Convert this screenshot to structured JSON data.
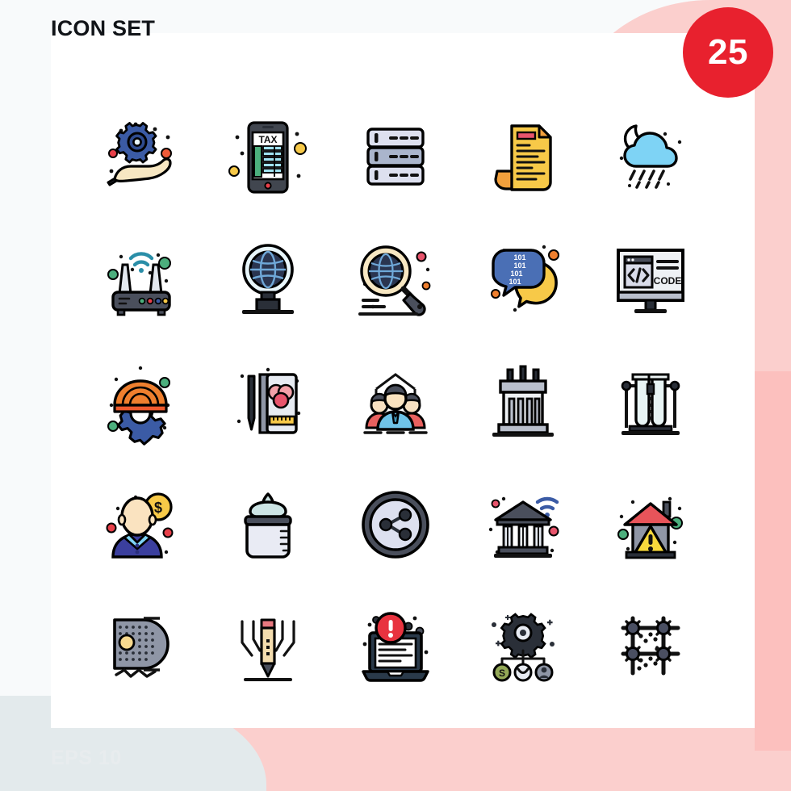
{
  "header": {
    "title": "ICON SET",
    "badge_count": "25",
    "footer_note": "EPS 10"
  },
  "colors": {
    "badge_bg": "#e8212e",
    "badge_text": "#ffffff",
    "title_text": "#111418",
    "footer_text": "#e8ecee",
    "deco_pink": "#fbcfcd",
    "deco_pink_dark": "#fbbdbb",
    "deco_grey": "#e3eaec",
    "card_bg": "#ffffff",
    "page_bg": "#f8fafb",
    "stroke": "#000000",
    "blue": "#3b5ba5",
    "light_blue": "#7ed3f5",
    "yellow": "#f7c948",
    "orange": "#ef7f2e",
    "red": "#e8404a",
    "green": "#4caf7d",
    "cream": "#f7e7c2",
    "lavender": "#d9dcea",
    "slate": "#4a4f5c",
    "teal": "#54c3d8"
  },
  "grid": {
    "rows": 5,
    "columns": 5,
    "total": 25
  },
  "icons": [
    {
      "index": 1,
      "name": "hand-gear-support-icon",
      "label": "Hand with Gear"
    },
    {
      "index": 2,
      "name": "mobile-tax-icon",
      "label": "Mobile Tax",
      "text": "TAX"
    },
    {
      "index": 3,
      "name": "server-rack-icon",
      "label": "Server Rack"
    },
    {
      "index": 4,
      "name": "invoice-document-icon",
      "label": "Invoice Document"
    },
    {
      "index": 5,
      "name": "night-rain-cloud-icon",
      "label": "Night Rain Cloud"
    },
    {
      "index": 6,
      "name": "wifi-router-icon",
      "label": "Wifi Router"
    },
    {
      "index": 7,
      "name": "globe-stand-icon",
      "label": "Globe on Stand"
    },
    {
      "index": 8,
      "name": "global-search-icon",
      "label": "Global Search"
    },
    {
      "index": 9,
      "name": "binary-chat-icon",
      "label": "Binary Chat",
      "text": "101"
    },
    {
      "index": 10,
      "name": "monitor-code-icon",
      "label": "Monitor Code",
      "text": "CODE"
    },
    {
      "index": 11,
      "name": "helmet-gear-engineering-icon",
      "label": "Helmet with Gear"
    },
    {
      "index": 12,
      "name": "design-book-icon",
      "label": "Design Book"
    },
    {
      "index": 13,
      "name": "team-group-icon",
      "label": "Team Group"
    },
    {
      "index": 14,
      "name": "factory-building-icon",
      "label": "Factory Building"
    },
    {
      "index": 15,
      "name": "test-tubes-icon",
      "label": "Test Tubes"
    },
    {
      "index": 16,
      "name": "businessman-money-icon",
      "label": "Businessman with Money",
      "text": "$"
    },
    {
      "index": 17,
      "name": "baby-bottle-icon",
      "label": "Baby Bottle"
    },
    {
      "index": 18,
      "name": "share-button-icon",
      "label": "Share Button"
    },
    {
      "index": 19,
      "name": "online-banking-icon",
      "label": "Online Banking"
    },
    {
      "index": 20,
      "name": "house-warning-icon",
      "label": "House Warning"
    },
    {
      "index": 21,
      "name": "speaker-grill-icon",
      "label": "Speaker Grill"
    },
    {
      "index": 22,
      "name": "pencil-precision-icon",
      "label": "Pencil Precision"
    },
    {
      "index": 23,
      "name": "laptop-error-icon",
      "label": "Laptop Error"
    },
    {
      "index": 24,
      "name": "gear-network-icon",
      "label": "Gear Network",
      "text": "S"
    },
    {
      "index": 25,
      "name": "node-grid-icon",
      "label": "Node Grid"
    }
  ]
}
